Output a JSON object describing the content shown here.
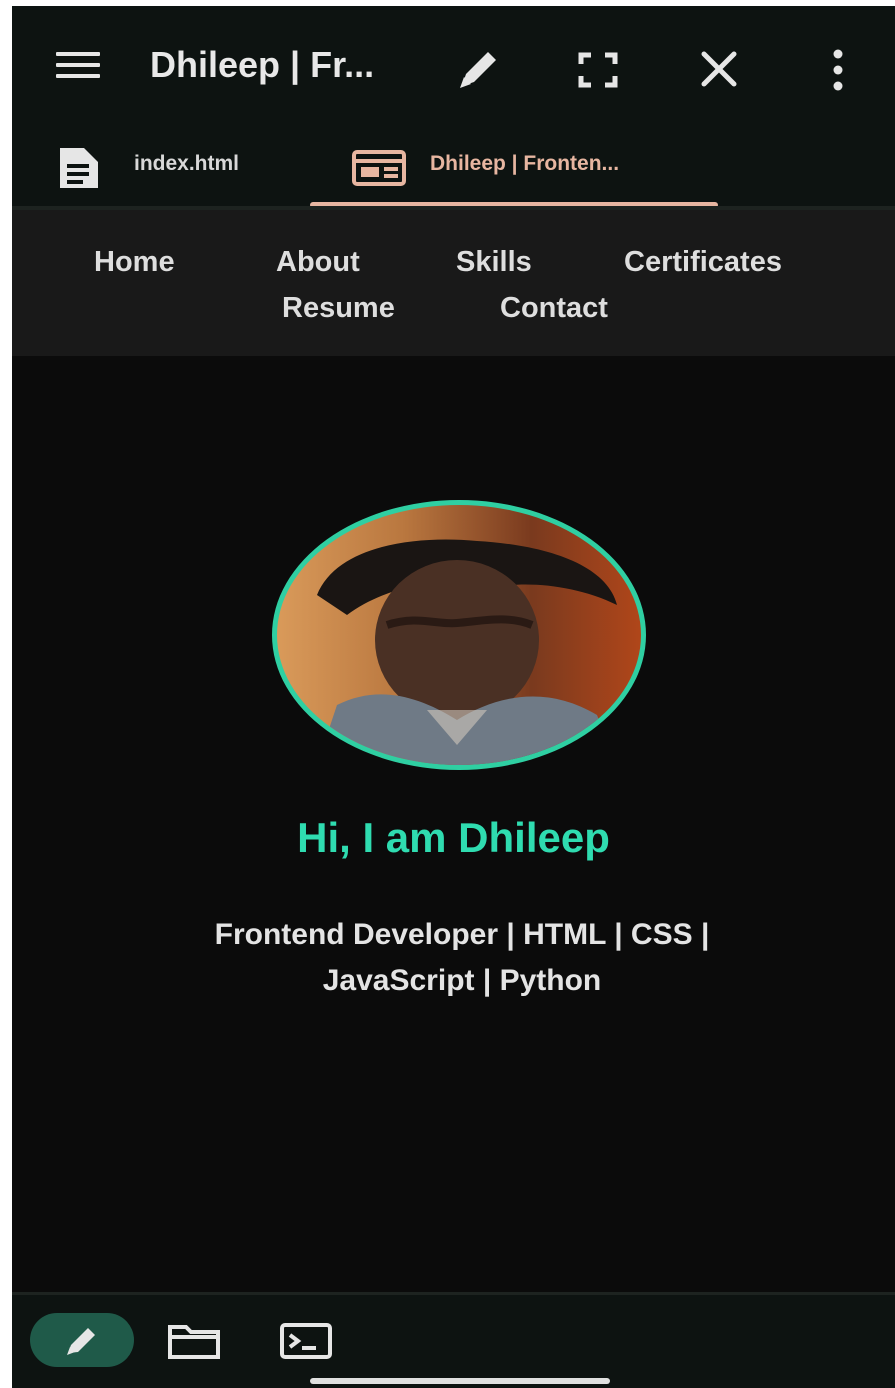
{
  "appbar": {
    "title": "Dhileep | Fr...",
    "icons": [
      "menu-icon",
      "pencil-icon",
      "fullscreen-icon",
      "close-icon",
      "more-vert-icon"
    ]
  },
  "tabs": [
    {
      "label": "index.html",
      "icon": "file-document-icon",
      "active": false
    },
    {
      "label": "Dhileep | Fronten...",
      "icon": "browser-preview-icon",
      "active": true
    }
  ],
  "site_nav": {
    "links": [
      "Home",
      "About",
      "Skills",
      "Certificates",
      "Resume",
      "Contact"
    ]
  },
  "hero": {
    "title": "Hi, I am Dhileep",
    "subtitle_line1": "Frontend Developer | HTML | CSS |",
    "subtitle_line2": "JavaScript | Python"
  },
  "bottombar": {
    "icons": [
      "pencil-icon",
      "folder-icon",
      "terminal-icon"
    ]
  },
  "colors": {
    "accent": "#2fdcb0",
    "tab_accent": "#e7b6a1",
    "background": "#0b0b0b",
    "nav_background": "#191919"
  }
}
